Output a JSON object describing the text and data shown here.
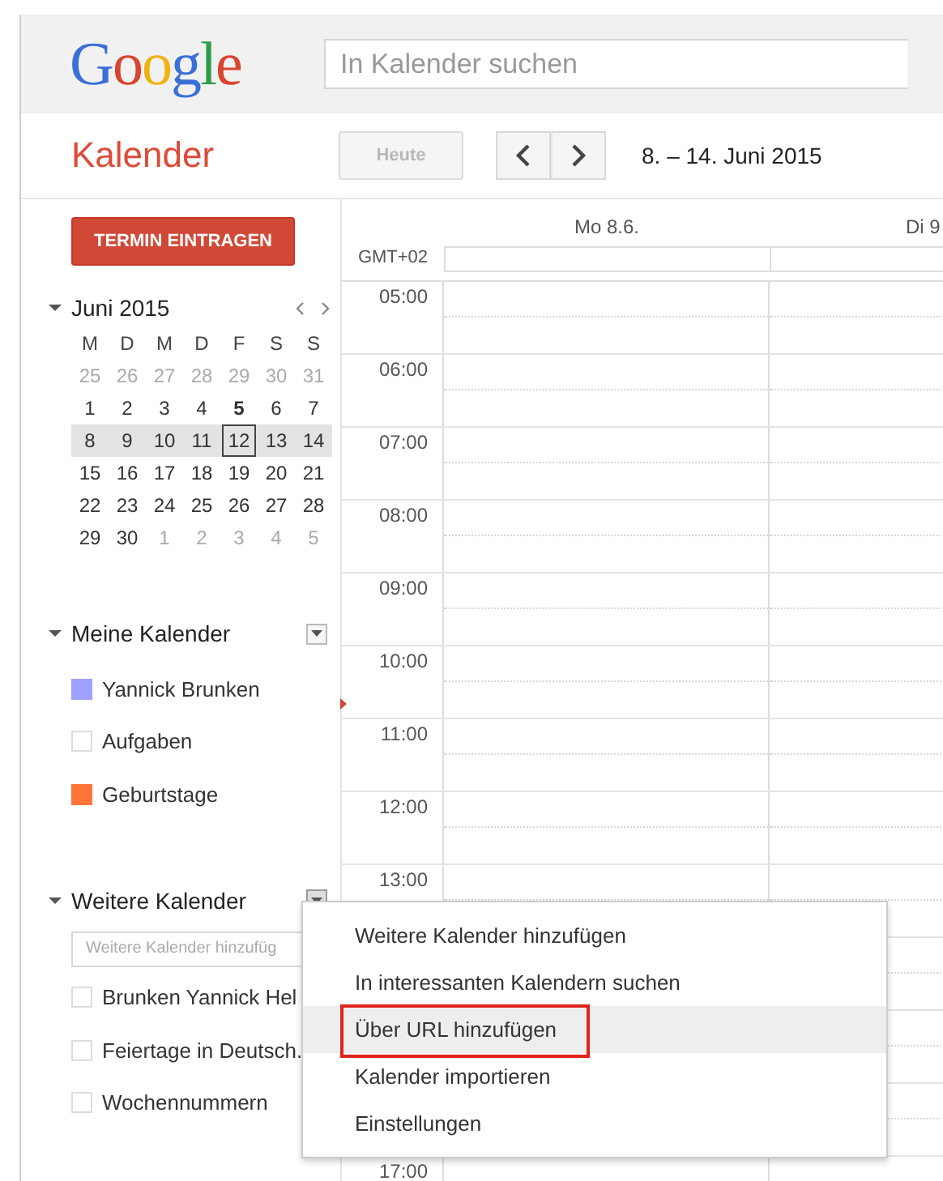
{
  "header": {
    "logo": "Google",
    "search": {
      "placeholder": "In Kalender suchen"
    }
  },
  "toolbar": {
    "app_title": "Kalender",
    "today_button": {
      "label": "Heute",
      "disabled": true
    },
    "date_range": "8. – 14. Juni 2015"
  },
  "create_button": "TERMIN EINTRAGEN",
  "mini_calendar": {
    "title": "Juni 2015",
    "expanded": true,
    "weekdays": [
      "M",
      "D",
      "M",
      "D",
      "F",
      "S",
      "S"
    ],
    "weeks": [
      {
        "selected": false,
        "days": [
          {
            "label": "25",
            "muted": true
          },
          {
            "label": "26",
            "muted": true
          },
          {
            "label": "27",
            "muted": true
          },
          {
            "label": "28",
            "muted": true
          },
          {
            "label": "29",
            "muted": true
          },
          {
            "label": "30",
            "muted": true
          },
          {
            "label": "31",
            "muted": true
          }
        ]
      },
      {
        "selected": false,
        "days": [
          {
            "label": "1",
            "muted": false
          },
          {
            "label": "2",
            "muted": false
          },
          {
            "label": "3",
            "muted": false
          },
          {
            "label": "4",
            "muted": false
          },
          {
            "label": "5",
            "muted": false,
            "bold": true
          },
          {
            "label": "6",
            "muted": false
          },
          {
            "label": "7",
            "muted": false
          }
        ]
      },
      {
        "selected": true,
        "days": [
          {
            "label": "8",
            "muted": false
          },
          {
            "label": "9",
            "muted": false
          },
          {
            "label": "10",
            "muted": false
          },
          {
            "label": "11",
            "muted": false
          },
          {
            "label": "12",
            "muted": false,
            "today": true
          },
          {
            "label": "13",
            "muted": false
          },
          {
            "label": "14",
            "muted": false
          }
        ]
      },
      {
        "selected": false,
        "days": [
          {
            "label": "15",
            "muted": false
          },
          {
            "label": "16",
            "muted": false
          },
          {
            "label": "17",
            "muted": false
          },
          {
            "label": "18",
            "muted": false
          },
          {
            "label": "19",
            "muted": false
          },
          {
            "label": "20",
            "muted": false
          },
          {
            "label": "21",
            "muted": false
          }
        ]
      },
      {
        "selected": false,
        "days": [
          {
            "label": "22",
            "muted": false
          },
          {
            "label": "23",
            "muted": false
          },
          {
            "label": "24",
            "muted": false
          },
          {
            "label": "25",
            "muted": false
          },
          {
            "label": "26",
            "muted": false
          },
          {
            "label": "27",
            "muted": false
          },
          {
            "label": "28",
            "muted": false
          }
        ]
      },
      {
        "selected": false,
        "days": [
          {
            "label": "29",
            "muted": false
          },
          {
            "label": "30",
            "muted": false
          },
          {
            "label": "1",
            "muted": true
          },
          {
            "label": "2",
            "muted": true
          },
          {
            "label": "3",
            "muted": true
          },
          {
            "label": "4",
            "muted": true
          },
          {
            "label": "5",
            "muted": true
          }
        ]
      }
    ]
  },
  "my_calendars": {
    "title": "Meine Kalender",
    "expanded": true,
    "items": [
      {
        "label": "Yannick Brunken",
        "checked": true,
        "color": "#9fa0ff"
      },
      {
        "label": "Aufgaben",
        "checked": false
      },
      {
        "label": "Geburtstage",
        "checked": true,
        "color": "#ff7537"
      }
    ]
  },
  "other_calendars": {
    "title": "Weitere Kalender",
    "expanded": true,
    "add_field": {
      "placeholder": "Weitere Kalender hinzufüg"
    },
    "items": [
      {
        "label": "Brunken Yannick Hel",
        "checked": false
      },
      {
        "label": "Feiertage in Deutsch.",
        "checked": false
      },
      {
        "label": "Wochennummern",
        "checked": false
      }
    ]
  },
  "week_view": {
    "timezone": "GMT+02",
    "days": [
      "Mo 8.6.",
      "Di 9"
    ],
    "hours": [
      "05:00",
      "06:00",
      "07:00",
      "08:00",
      "09:00",
      "10:00",
      "11:00",
      "12:00",
      "13:00"
    ],
    "hours_after_menu": [
      "17:00"
    ]
  },
  "menu": {
    "items": [
      {
        "label": "Weitere Kalender hinzufügen",
        "selected": false
      },
      {
        "label": "In interessanten Kalendern suchen",
        "selected": false
      },
      {
        "label": "Über URL hinzufügen",
        "selected": true
      },
      {
        "label": "Kalender importieren",
        "selected": false
      },
      {
        "label": "Einstellungen",
        "selected": false
      }
    ]
  }
}
